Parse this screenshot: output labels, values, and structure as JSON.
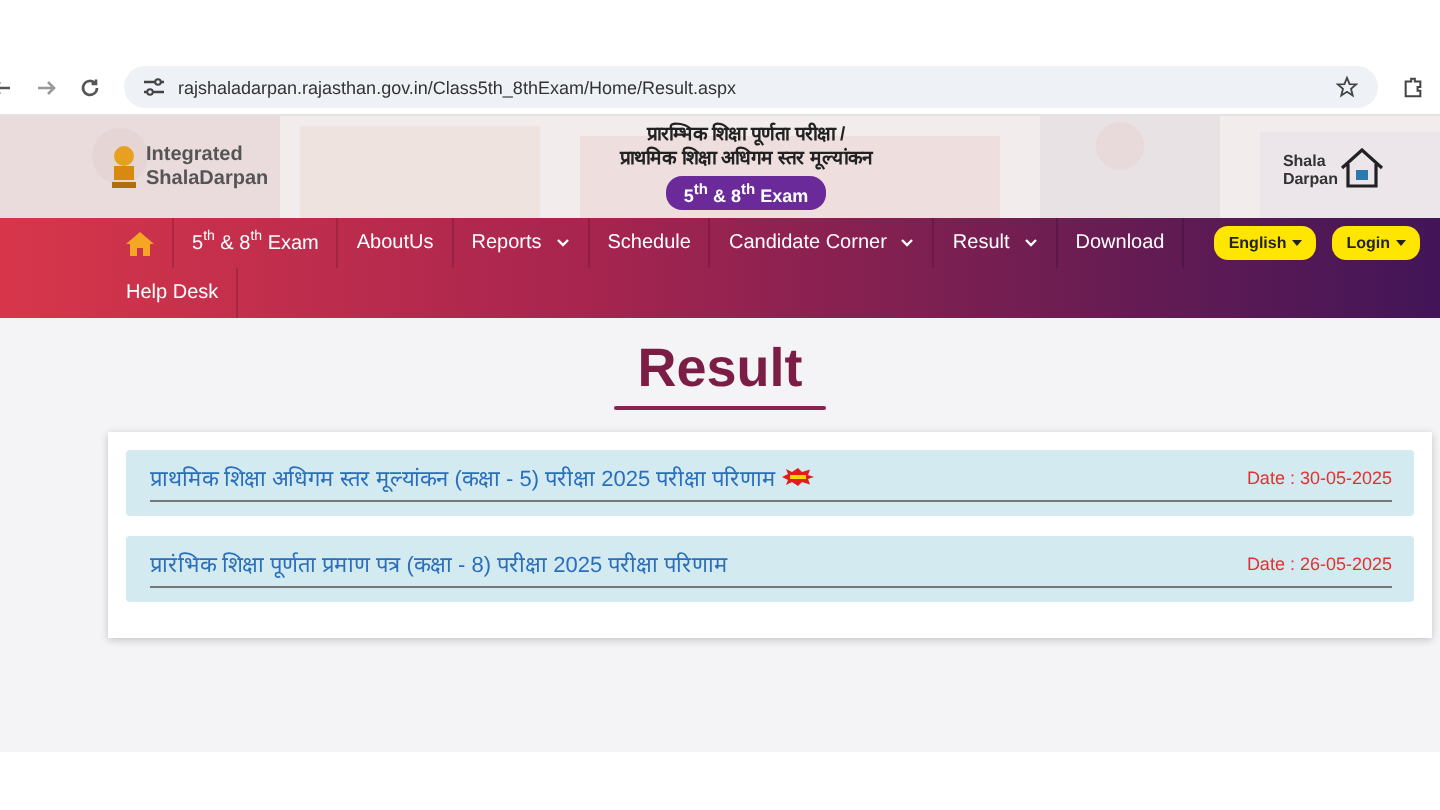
{
  "browser": {
    "url": "rajshaladarpan.rajasthan.gov.in/Class5th_8thExam/Home/Result.aspx"
  },
  "header": {
    "logo_text": [
      "Integrated",
      "ShalaDarpan"
    ],
    "title_lines": [
      "प्रारम्भिक शिक्षा पूर्णता परीक्षा /",
      "प्राथमिक शिक्षा अधिगम स्तर मूल्यांकन"
    ],
    "exam_badge": "5$^{th}$ & 8$^{th}$ Exam",
    "right_logo": [
      "Shala",
      "Darpan"
    ]
  },
  "nav": {
    "items": [
      {
        "label": "5$^{th}$ & 8$^{th}$ Exam",
        "dropdown": false
      },
      {
        "label": "AboutUs",
        "dropdown": false
      },
      {
        "label": "Reports",
        "dropdown": true
      },
      {
        "label": "Schedule",
        "dropdown": false
      },
      {
        "label": "Candidate Corner",
        "dropdown": true
      },
      {
        "label": "Result",
        "dropdown": true
      },
      {
        "label": "Download",
        "dropdown": false
      },
      {
        "label": "Help Desk",
        "dropdown": false
      }
    ],
    "buttons": [
      "English",
      "Login"
    ]
  },
  "page_title": "Result",
  "results": [
    {
      "title": "प्राथमिक शिक्षा अधिगम स्तर मूल्यांकन (कक्षा - 5) परीक्षा 2025 परीक्षा परिणाम",
      "new": true,
      "date": "Date : 30-05-2025"
    },
    {
      "title": "प्रारंभिक शिक्षा पूर्णता प्रमाण पत्र (कक्षा - 8) परीक्षा 2025 परीक्षा परिणाम",
      "new": false,
      "date": "Date : 26-05-2025"
    }
  ]
}
